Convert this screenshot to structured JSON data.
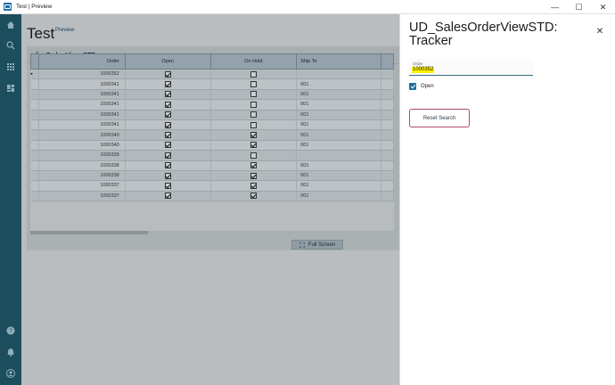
{
  "window": {
    "title": "Test | Preview",
    "controls": {
      "minimize": "—",
      "maximize": "☐",
      "close": "✕"
    }
  },
  "sidebar": {
    "top_icons": [
      "home-icon",
      "search-icon",
      "apps-grid-icon",
      "dashboard-icon"
    ],
    "bottom_icons": [
      "help-icon",
      "notification-bell-icon",
      "user-account-icon"
    ]
  },
  "page": {
    "title": "Test",
    "subtitle": "Preview"
  },
  "card": {
    "collapse_glyph": "^",
    "title": "Order View STD"
  },
  "grid": {
    "columns": [
      "Order",
      "Open",
      "On Hold",
      "Ship To"
    ],
    "current_row_marker": "▸",
    "rows": [
      {
        "order": "1000352",
        "open": true,
        "on_hold": false,
        "ship_to": ""
      },
      {
        "order": "1000341",
        "open": true,
        "on_hold": false,
        "ship_to": "001"
      },
      {
        "order": "1000341",
        "open": true,
        "on_hold": false,
        "ship_to": "001"
      },
      {
        "order": "1000341",
        "open": true,
        "on_hold": false,
        "ship_to": "001"
      },
      {
        "order": "1000341",
        "open": true,
        "on_hold": false,
        "ship_to": "001"
      },
      {
        "order": "1000341",
        "open": true,
        "on_hold": false,
        "ship_to": "001"
      },
      {
        "order": "1000340",
        "open": true,
        "on_hold": true,
        "ship_to": "001"
      },
      {
        "order": "1000340",
        "open": true,
        "on_hold": true,
        "ship_to": "001"
      },
      {
        "order": "1000339",
        "open": true,
        "on_hold": false,
        "ship_to": ""
      },
      {
        "order": "1000338",
        "open": true,
        "on_hold": true,
        "ship_to": "001"
      },
      {
        "order": "1000338",
        "open": true,
        "on_hold": true,
        "ship_to": "001"
      },
      {
        "order": "1000337",
        "open": true,
        "on_hold": true,
        "ship_to": "001"
      },
      {
        "order": "1000337",
        "open": true,
        "on_hold": true,
        "ship_to": "001"
      }
    ]
  },
  "fullscreen": {
    "label": "Full Screen"
  },
  "tracker": {
    "title": "UD_SalesOrderViewSTD: Tracker",
    "close_glyph": "✕",
    "order_field": {
      "label": "Order",
      "value": "1000352"
    },
    "open_checkbox": {
      "label": "Open",
      "checked": true
    },
    "reset_button": "Reset Search"
  },
  "colors": {
    "sidebar": "#1c4e5d",
    "highlight": "#fff200",
    "checkbox_accent": "#1d6ea4",
    "reset_border": "#b04a62"
  }
}
